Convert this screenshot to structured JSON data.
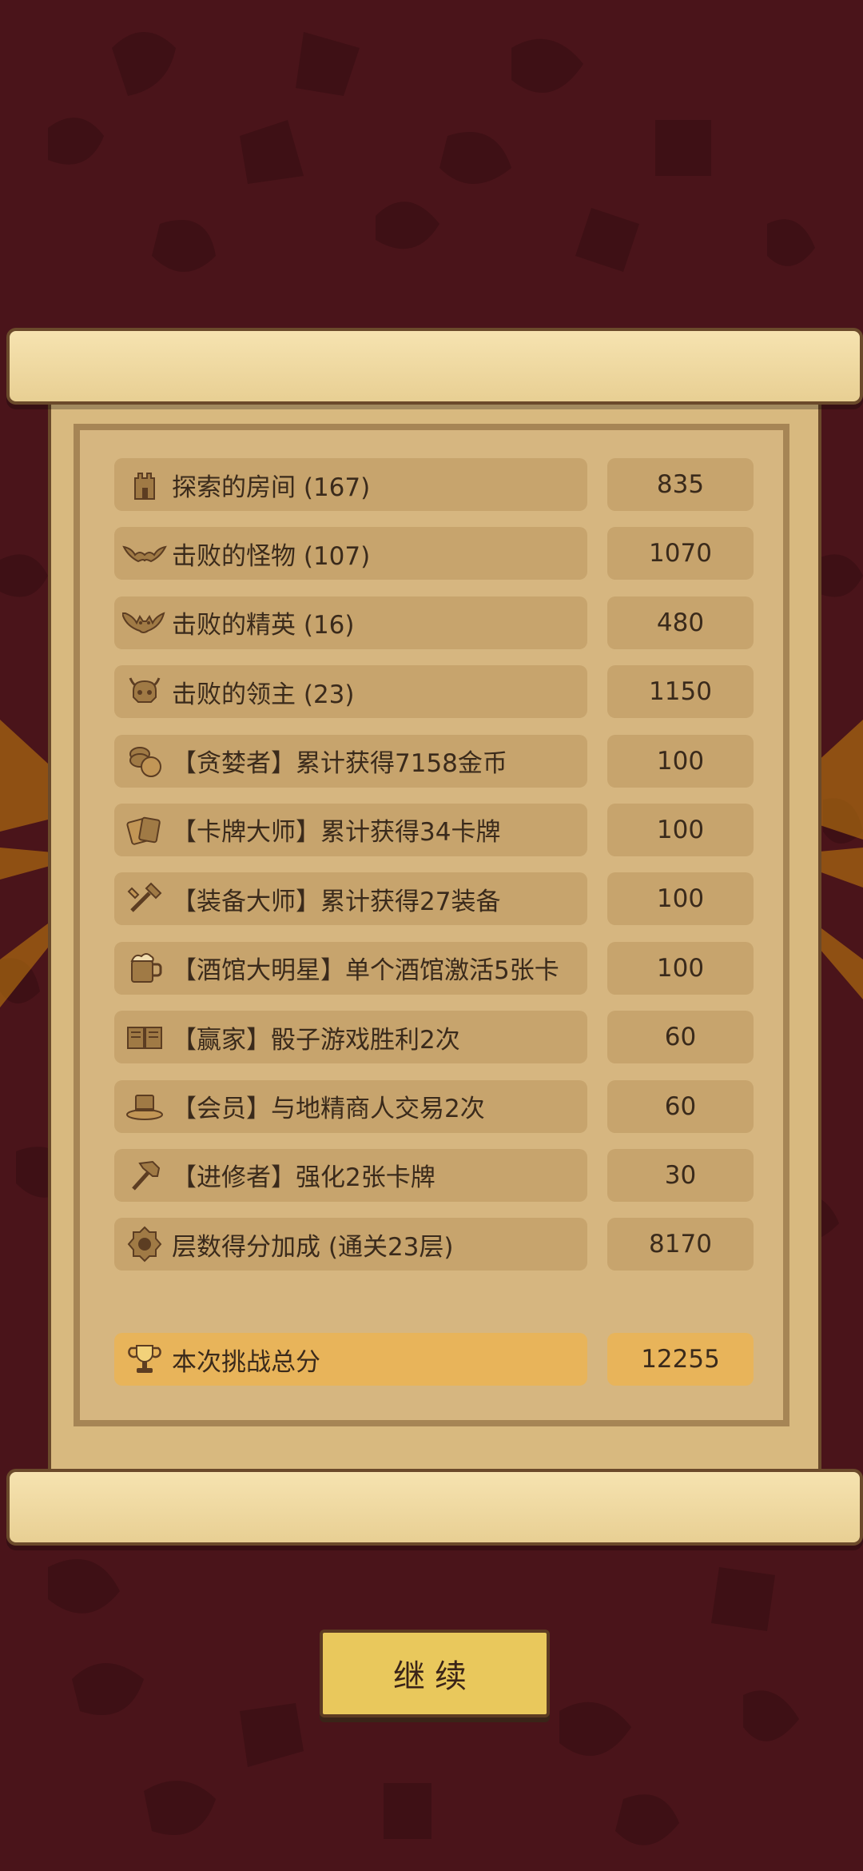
{
  "rows": [
    {
      "label": "探索的房间 (167)",
      "value": "835",
      "icon": "tower-icon"
    },
    {
      "label": "击败的怪物 (107)",
      "value": "1070",
      "icon": "bat-icon"
    },
    {
      "label": "击败的精英 (16)",
      "value": "480",
      "icon": "elite-demon-icon"
    },
    {
      "label": "击败的领主 (23)",
      "value": "1150",
      "icon": "boss-skull-icon"
    },
    {
      "label": "【贪婪者】累计获得7158金币",
      "value": "100",
      "icon": "coins-icon"
    },
    {
      "label": "【卡牌大师】累计获得34卡牌",
      "value": "100",
      "icon": "cards-icon"
    },
    {
      "label": "【装备大师】累计获得27装备",
      "value": "100",
      "icon": "equipment-icon"
    },
    {
      "label": "【酒馆大明星】单个酒馆激活5张卡",
      "value": "100",
      "icon": "beer-mug-icon"
    },
    {
      "label": "【赢家】骰子游戏胜利2次",
      "value": "60",
      "icon": "book-icon"
    },
    {
      "label": "【会员】与地精商人交易2次",
      "value": "60",
      "icon": "top-hat-icon"
    },
    {
      "label": "【进修者】强化2张卡牌",
      "value": "30",
      "icon": "hammer-icon"
    },
    {
      "label": "层数得分加成 (通关23层)",
      "value": "8170",
      "icon": "floor-badge-icon"
    }
  ],
  "total": {
    "label": "本次挑战总分",
    "value": "12255",
    "icon": "trophy-icon"
  },
  "continue_label": "继续"
}
